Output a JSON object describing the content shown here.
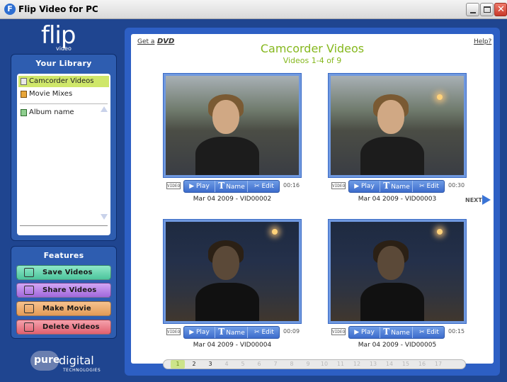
{
  "window": {
    "title": "Flip Video for PC",
    "app_icon": "flip-app-icon",
    "close_glyph": "✕"
  },
  "logo": {
    "main": "flip",
    "sub": "video"
  },
  "library": {
    "heading": "Your Library",
    "items": [
      {
        "label": "Camcorder Videos",
        "icon": "camcorder-icon",
        "selected": true
      },
      {
        "label": "Movie Mixes",
        "icon": "movie-mix-icon",
        "selected": false
      },
      {
        "label": "Album name",
        "icon": "album-icon",
        "selected": false
      }
    ]
  },
  "features": {
    "heading": "Features",
    "buttons": [
      {
        "label": "Save Videos",
        "icon": "save-icon",
        "color": "#5ccfa6"
      },
      {
        "label": "Share Videos",
        "icon": "share-icon",
        "color": "#b07ae3"
      },
      {
        "label": "Make Movie",
        "icon": "film-icon",
        "color": "#eba663"
      },
      {
        "label": "Delete Videos",
        "icon": "trash-icon",
        "color": "#e8707d"
      }
    ]
  },
  "brand": {
    "pure": "pure",
    "digital": "digital",
    "sub": "TECHNOLOGIES"
  },
  "main": {
    "get_dvd": "Get a",
    "dvd_logo": "DVD",
    "help": "Help?",
    "title": "Camcorder Videos",
    "subtitle": "Videos 1-4 of 9",
    "next": "NEXT",
    "accent_color": "#86b81e"
  },
  "video_controls": {
    "tag": "VIDEO",
    "play": "Play",
    "name": "Name",
    "edit": "Edit",
    "play_glyph": "▶",
    "name_glyph": "T",
    "edit_glyph": "✂"
  },
  "videos": [
    {
      "caption": "Mar 04 2009 - VID00002",
      "duration": "00:16"
    },
    {
      "caption": "Mar 04 2009 - VID00003",
      "duration": "00:30"
    },
    {
      "caption": "Mar 04 2009 - VID00004",
      "duration": "00:09"
    },
    {
      "caption": "Mar 04 2009 - VID00005",
      "duration": "00:15"
    }
  ],
  "pager": {
    "pages": [
      "1",
      "2",
      "3",
      "4",
      "5",
      "6",
      "7",
      "8",
      "9",
      "10",
      "11",
      "12",
      "13",
      "14",
      "15",
      "16",
      "17"
    ],
    "current": "1"
  }
}
